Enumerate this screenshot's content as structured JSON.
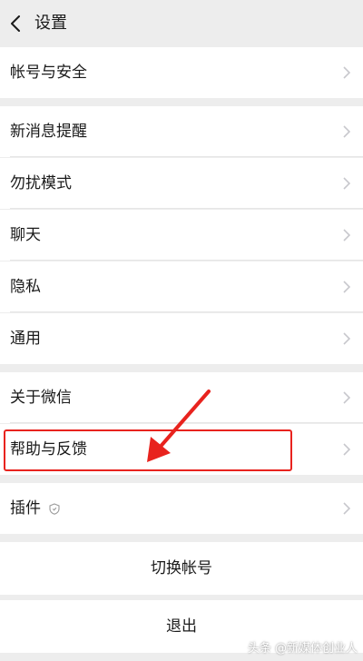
{
  "header": {
    "title": "设置"
  },
  "sections": [
    {
      "items": [
        {
          "label": "帐号与安全"
        }
      ]
    },
    {
      "items": [
        {
          "label": "新消息提醒"
        },
        {
          "label": "勿扰模式"
        },
        {
          "label": "聊天"
        },
        {
          "label": "隐私"
        },
        {
          "label": "通用"
        }
      ]
    },
    {
      "items": [
        {
          "label": "关于微信"
        },
        {
          "label": "帮助与反馈"
        }
      ]
    },
    {
      "items": [
        {
          "label": "插件"
        }
      ]
    }
  ],
  "actions": {
    "switch_account": "切换帐号",
    "logout": "退出"
  },
  "annotation": {
    "highlight_color": "#e8231e"
  },
  "watermark": "头条 @新媒体创业人",
  "colors": {
    "background": "#ededed",
    "row": "#ffffff",
    "text": "#1a1a1a",
    "chevron": "#c7c7cc"
  }
}
